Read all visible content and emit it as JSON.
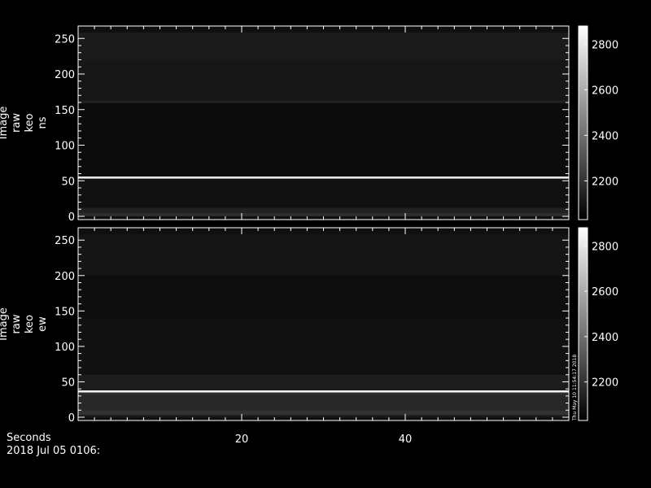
{
  "chart_data": [
    {
      "type": "heatmap",
      "ylabel_lines": [
        "Image",
        "raw",
        "keo",
        "ns"
      ],
      "xlim": [
        0,
        60
      ],
      "ylim": [
        0,
        256
      ],
      "xticks": [
        20,
        40
      ],
      "yticks": [
        0,
        50,
        100,
        150,
        200,
        250
      ],
      "colorbar": {
        "range": [
          2030,
          2880
        ],
        "ticks": [
          2200,
          2400,
          2600,
          2800
        ]
      },
      "bands": [
        {
          "y": [
            0,
            5
          ],
          "value": 2180
        },
        {
          "y": [
            5,
            12
          ],
          "value": 2140
        },
        {
          "y": [
            12,
            53
          ],
          "value": 2085
        },
        {
          "y": [
            53,
            56
          ],
          "value": 2800
        },
        {
          "y": [
            56,
            159
          ],
          "value": 2070
        },
        {
          "y": [
            159,
            163
          ],
          "value": 2140
        },
        {
          "y": [
            163,
            220
          ],
          "value": 2105
        },
        {
          "y": [
            220,
            258
          ],
          "value": 2120
        }
      ]
    },
    {
      "type": "heatmap",
      "ylabel_lines": [
        "Image",
        "raw",
        "keo",
        "ew"
      ],
      "xlim": [
        0,
        60
      ],
      "ylim": [
        0,
        256
      ],
      "xticks": [
        20,
        40
      ],
      "yticks": [
        0,
        50,
        100,
        150,
        200,
        250
      ],
      "colorbar": {
        "range": [
          2030,
          2880
        ],
        "ticks": [
          2200,
          2400,
          2600,
          2800
        ],
        "side_text": "Thu May 10 11:54:17 2018"
      },
      "bands": [
        {
          "y": [
            0,
            3
          ],
          "value": 2120
        },
        {
          "y": [
            3,
            10
          ],
          "value": 2195
        },
        {
          "y": [
            10,
            30
          ],
          "value": 2160
        },
        {
          "y": [
            30,
            35
          ],
          "value": 2175
        },
        {
          "y": [
            35,
            38
          ],
          "value": 2840
        },
        {
          "y": [
            38,
            60
          ],
          "value": 2125
        },
        {
          "y": [
            60,
            140
          ],
          "value": 2085
        },
        {
          "y": [
            140,
            200
          ],
          "value": 2075
        },
        {
          "y": [
            200,
            258
          ],
          "value": 2100
        }
      ]
    }
  ],
  "footer": {
    "xlabel": "Seconds",
    "date": "2018 Jul 05 0106:"
  }
}
